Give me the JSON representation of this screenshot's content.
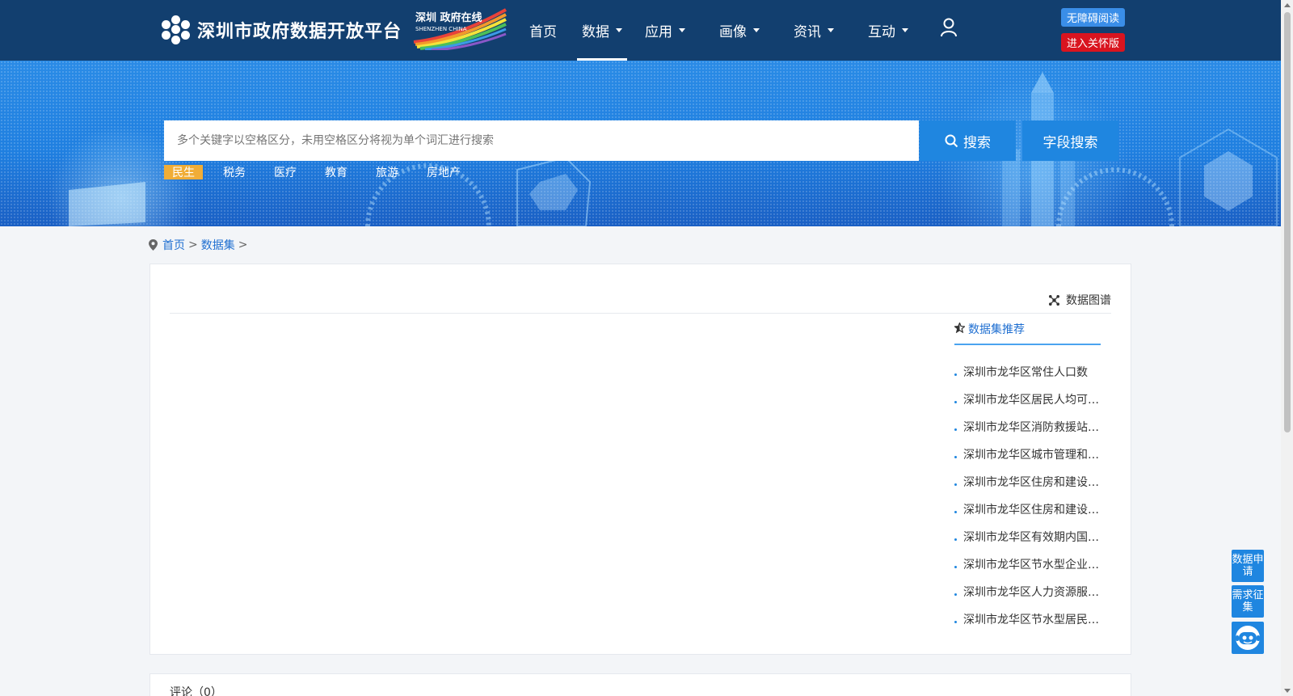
{
  "header": {
    "site_title": "深圳市政府数据开放平台",
    "partner_logo_text": "深圳 政府在线",
    "partner_logo_sub": "SHENZHEN CHINA",
    "nav": [
      {
        "label": "首页",
        "has_menu": false
      },
      {
        "label": "数据",
        "has_menu": true,
        "active": true
      },
      {
        "label": "应用",
        "has_menu": true
      },
      {
        "label": "画像",
        "has_menu": true
      },
      {
        "label": "资讯",
        "has_menu": true
      },
      {
        "label": "互动",
        "has_menu": true
      }
    ],
    "accessibility_label": "无障碍阅读",
    "care_mode_label": "进入关怀版"
  },
  "search": {
    "placeholder": "多个关键字以空格区分，未用空格区分将视为单个词汇进行搜索",
    "search_label": "搜索",
    "field_search_label": "字段搜索",
    "hot_tags": [
      "民生",
      "税务",
      "医疗",
      "教育",
      "旅游",
      "房地产"
    ]
  },
  "breadcrumb": {
    "home": "首页",
    "dataset": "数据集",
    "sep": ">"
  },
  "detail": {
    "graph_label": "数据图谱",
    "recommend_title": "数据集推荐",
    "recommendations": [
      "深圳市龙华区常住人口数",
      "深圳市龙华区居民人均可支配收入",
      "深圳市龙华区消防救援站信息",
      "深圳市龙华区城市管理和综合执法局",
      "深圳市龙华区住房和建设局信息",
      "深圳市龙华区住房和建设局数据",
      "深圳市龙华区有效期内国家高新技术企业",
      "深圳市龙华区节水型企业名单",
      "深圳市龙华区人力资源服务机构",
      "深圳市龙华区节水型居民小区"
    ]
  },
  "comments": {
    "title": "评论（0）"
  },
  "floating": {
    "data_apply": "数据申请",
    "demand_collect": "需求征集"
  },
  "colors": {
    "header_bg": "#123f6f",
    "accent": "#1f86e0",
    "tag_active": "#f0ad37",
    "care_red": "#d9141f"
  }
}
